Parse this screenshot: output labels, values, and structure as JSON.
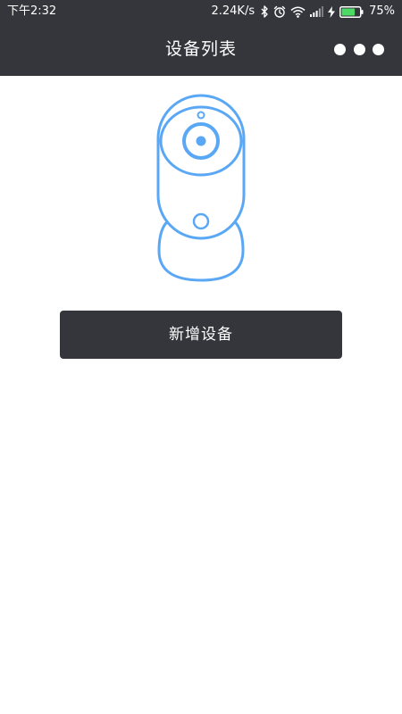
{
  "status_bar": {
    "time": "下午2:32",
    "network_speed": "2.24K/s",
    "battery_percent": "75%",
    "battery_level": 0.75,
    "battery_color": "#4cd964",
    "icons": [
      "bluetooth-icon",
      "alarm-icon",
      "wifi-icon",
      "signal-icon",
      "charging-icon",
      "battery-icon"
    ]
  },
  "header": {
    "title": "设备列表",
    "more_icon": "more-dots-icon"
  },
  "main": {
    "illustration": "camera-icon",
    "add_device_label": "新增设备"
  },
  "colors": {
    "header_bg": "#35363c",
    "button_bg": "#35363c",
    "accent": "#5aa8f5",
    "background": "#ffffff"
  }
}
